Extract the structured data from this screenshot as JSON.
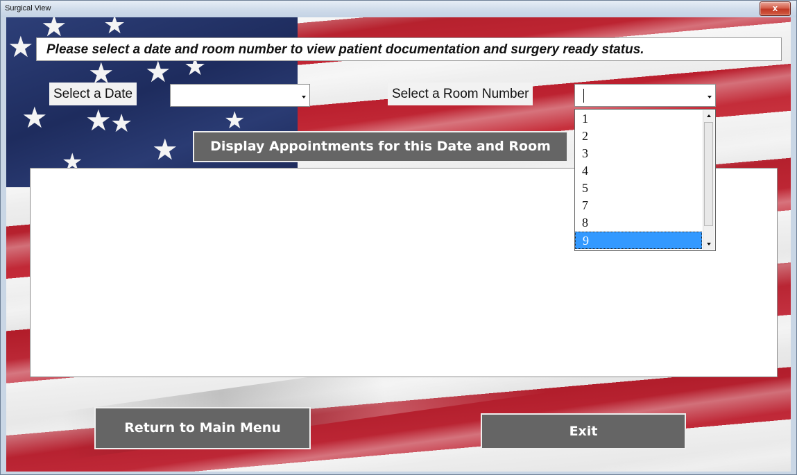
{
  "window": {
    "title": "Surgical View",
    "close_glyph": "x"
  },
  "banner": {
    "text": "Please select a date and room number to view patient documentation and surgery ready status."
  },
  "date_select": {
    "label": "Select a Date",
    "value": ""
  },
  "room_select": {
    "label": "Select a Room Number",
    "value": "",
    "options": [
      "1",
      "2",
      "3",
      "4",
      "5",
      "7",
      "8",
      "9"
    ],
    "highlighted": "9"
  },
  "buttons": {
    "display": "Display Appointments for this Date and Room",
    "return": "Return to Main Menu",
    "exit": "Exit"
  },
  "icons": {
    "dropdown_arrow": "chevron-down-icon",
    "scroll_up": "scroll-up-arrow-icon",
    "scroll_down": "scroll-down-arrow-icon",
    "close": "close-icon"
  },
  "colors": {
    "button_gray": "#656565",
    "selection_blue": "#3399ff",
    "close_red": "#c13a26"
  }
}
